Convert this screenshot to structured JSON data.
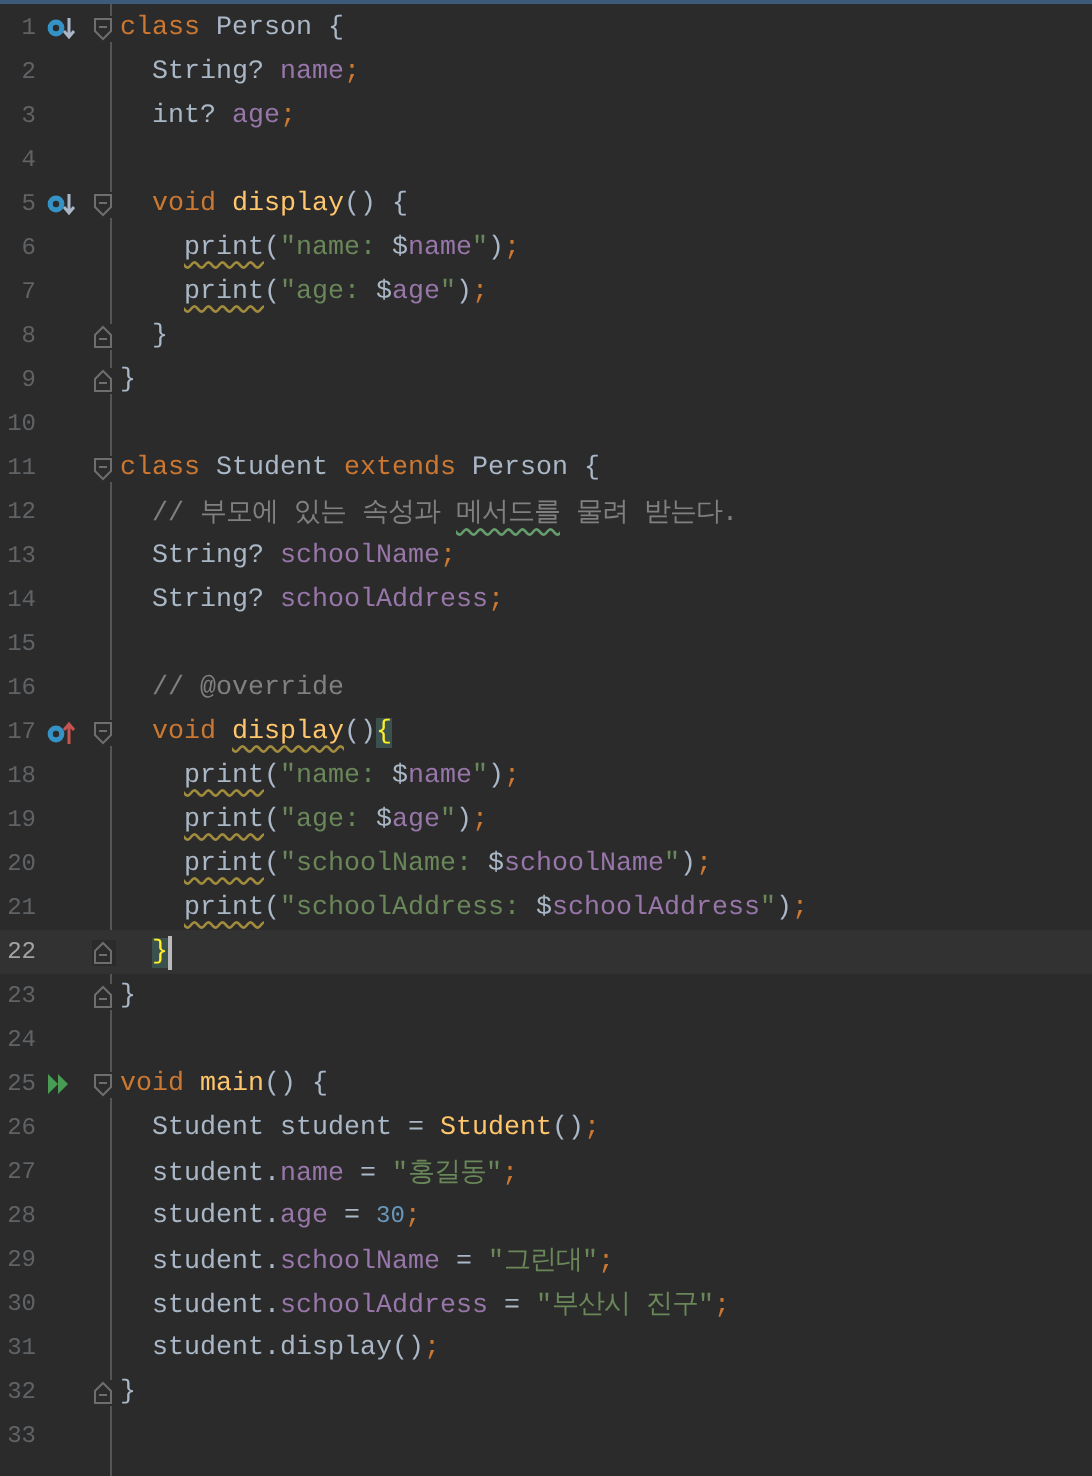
{
  "editor": {
    "lines": [
      {
        "number": "1",
        "gutter": {
          "kind": "implemented"
        },
        "fold": {
          "kind": "open"
        },
        "current": false,
        "tokens": [
          {
            "text": "class",
            "kind": "kw"
          },
          {
            "text": " Person {",
            "kind": "plain"
          }
        ]
      },
      {
        "number": "2",
        "current": false,
        "tokens": [
          {
            "text": "  String? ",
            "kind": "plain"
          },
          {
            "text": "name",
            "kind": "field"
          },
          {
            "text": ";",
            "kind": "punct"
          }
        ]
      },
      {
        "number": "3",
        "current": false,
        "tokens": [
          {
            "text": "  int? ",
            "kind": "plain"
          },
          {
            "text": "age",
            "kind": "field"
          },
          {
            "text": ";",
            "kind": "punct"
          }
        ]
      },
      {
        "number": "4",
        "current": false
      },
      {
        "number": "5",
        "gutter": {
          "kind": "implemented"
        },
        "fold": {
          "kind": "open"
        },
        "current": false,
        "tokens": [
          {
            "text": "  void ",
            "kind": "kw"
          },
          {
            "text": "display",
            "kind": "fn"
          },
          {
            "text": "() {",
            "kind": "plain"
          }
        ]
      },
      {
        "number": "6",
        "current": false,
        "tokens": [
          {
            "text": "    print",
            "kind": "call-warning"
          },
          {
            "text": "(",
            "kind": "plain"
          },
          {
            "text": "\"name: ",
            "kind": "str"
          },
          {
            "text": "$",
            "kind": "plain"
          },
          {
            "text": "name",
            "kind": "field"
          },
          {
            "text": "\"",
            "kind": "str"
          },
          {
            "text": ")",
            "kind": "plain"
          },
          {
            "text": ";",
            "kind": "punct"
          }
        ]
      },
      {
        "number": "7",
        "current": false,
        "tokens": [
          {
            "text": "    print",
            "kind": "call-warning"
          },
          {
            "text": "(",
            "kind": "plain"
          },
          {
            "text": "\"age: ",
            "kind": "str"
          },
          {
            "text": "$",
            "kind": "plain"
          },
          {
            "text": "age",
            "kind": "field"
          },
          {
            "text": "\"",
            "kind": "str"
          },
          {
            "text": ")",
            "kind": "plain"
          },
          {
            "text": ";",
            "kind": "punct"
          }
        ]
      },
      {
        "number": "8",
        "fold": {
          "kind": "close"
        },
        "current": false,
        "tokens": [
          {
            "text": "  }",
            "kind": "plain"
          }
        ]
      },
      {
        "number": "9",
        "fold": {
          "kind": "close"
        },
        "current": false,
        "tokens": [
          {
            "text": "}",
            "kind": "plain"
          }
        ]
      },
      {
        "number": "10",
        "current": false
      },
      {
        "number": "11",
        "fold": {
          "kind": "open"
        },
        "current": false,
        "tokens": [
          {
            "text": "class",
            "kind": "kw"
          },
          {
            "text": " Student ",
            "kind": "plain"
          },
          {
            "text": "extends",
            "kind": "kw"
          },
          {
            "text": " Person {",
            "kind": "plain"
          }
        ]
      },
      {
        "number": "12",
        "current": false,
        "tokens": [
          {
            "text": "  // 부모에 있는 속성과 ",
            "kind": "comment"
          },
          {
            "text": "메서드를",
            "kind": "comment-typo"
          },
          {
            "text": " 물려 받는다.",
            "kind": "comment"
          }
        ]
      },
      {
        "number": "13",
        "current": false,
        "tokens": [
          {
            "text": "  String? ",
            "kind": "plain"
          },
          {
            "text": "schoolName",
            "kind": "field"
          },
          {
            "text": ";",
            "kind": "punct"
          }
        ]
      },
      {
        "number": "14",
        "current": false,
        "tokens": [
          {
            "text": "  String? ",
            "kind": "plain"
          },
          {
            "text": "schoolAddress",
            "kind": "field"
          },
          {
            "text": ";",
            "kind": "punct"
          }
        ]
      },
      {
        "number": "15",
        "current": false
      },
      {
        "number": "16",
        "current": false,
        "tokens": [
          {
            "text": "  // @override",
            "kind": "comment"
          }
        ]
      },
      {
        "number": "17",
        "gutter": {
          "kind": "overrides"
        },
        "fold": {
          "kind": "open"
        },
        "current": false,
        "tokens": [
          {
            "text": "  void ",
            "kind": "kw"
          },
          {
            "text": "display",
            "kind": "fn-warning"
          },
          {
            "text": "()",
            "kind": "plain"
          },
          {
            "text": "{",
            "kind": "brace-match"
          }
        ]
      },
      {
        "number": "18",
        "current": false,
        "tokens": [
          {
            "text": "    print",
            "kind": "call-warning"
          },
          {
            "text": "(",
            "kind": "plain"
          },
          {
            "text": "\"name: ",
            "kind": "str"
          },
          {
            "text": "$",
            "kind": "plain"
          },
          {
            "text": "name",
            "kind": "field"
          },
          {
            "text": "\"",
            "kind": "str"
          },
          {
            "text": ")",
            "kind": "plain"
          },
          {
            "text": ";",
            "kind": "punct"
          }
        ]
      },
      {
        "number": "19",
        "current": false,
        "tokens": [
          {
            "text": "    print",
            "kind": "call-warning"
          },
          {
            "text": "(",
            "kind": "plain"
          },
          {
            "text": "\"age: ",
            "kind": "str"
          },
          {
            "text": "$",
            "kind": "plain"
          },
          {
            "text": "age",
            "kind": "field"
          },
          {
            "text": "\"",
            "kind": "str"
          },
          {
            "text": ")",
            "kind": "plain"
          },
          {
            "text": ";",
            "kind": "punct"
          }
        ]
      },
      {
        "number": "20",
        "current": false,
        "tokens": [
          {
            "text": "    print",
            "kind": "call-warning"
          },
          {
            "text": "(",
            "kind": "plain"
          },
          {
            "text": "\"schoolName: ",
            "kind": "str"
          },
          {
            "text": "$",
            "kind": "plain"
          },
          {
            "text": "schoolName",
            "kind": "field"
          },
          {
            "text": "\"",
            "kind": "str"
          },
          {
            "text": ")",
            "kind": "plain"
          },
          {
            "text": ";",
            "kind": "punct"
          }
        ]
      },
      {
        "number": "21",
        "current": false,
        "tokens": [
          {
            "text": "    print",
            "kind": "call-warning"
          },
          {
            "text": "(",
            "kind": "plain"
          },
          {
            "text": "\"schoolAddress: ",
            "kind": "str"
          },
          {
            "text": "$",
            "kind": "plain"
          },
          {
            "text": "schoolAddress",
            "kind": "field"
          },
          {
            "text": "\"",
            "kind": "str"
          },
          {
            "text": ")",
            "kind": "plain"
          },
          {
            "text": ";",
            "kind": "punct"
          }
        ]
      },
      {
        "number": "22",
        "fold": {
          "kind": "close"
        },
        "current": true,
        "tokens": [
          {
            "text": "  }",
            "kind": "brace-match"
          }
        ]
      },
      {
        "number": "23",
        "fold": {
          "kind": "close"
        },
        "current": false,
        "tokens": [
          {
            "text": "}",
            "kind": "plain"
          }
        ]
      },
      {
        "number": "24",
        "current": false
      },
      {
        "number": "25",
        "gutter": {
          "kind": "run"
        },
        "fold": {
          "kind": "open"
        },
        "current": false,
        "tokens": [
          {
            "text": "void ",
            "kind": "kw"
          },
          {
            "text": "main",
            "kind": "fn"
          },
          {
            "text": "() {",
            "kind": "plain"
          }
        ]
      },
      {
        "number": "26",
        "current": false,
        "tokens": [
          {
            "text": "  Student student = ",
            "kind": "plain"
          },
          {
            "text": "Student",
            "kind": "fn"
          },
          {
            "text": "()",
            "kind": "plain"
          },
          {
            "text": ";",
            "kind": "punct"
          }
        ]
      },
      {
        "number": "27",
        "current": false,
        "tokens": [
          {
            "text": "  student.",
            "kind": "plain"
          },
          {
            "text": "name",
            "kind": "field"
          },
          {
            "text": " = ",
            "kind": "plain"
          },
          {
            "text": "\"홍길동\"",
            "kind": "str"
          },
          {
            "text": ";",
            "kind": "punct"
          }
        ]
      },
      {
        "number": "28",
        "current": false,
        "tokens": [
          {
            "text": "  student.",
            "kind": "plain"
          },
          {
            "text": "age",
            "kind": "field"
          },
          {
            "text": " = ",
            "kind": "plain"
          },
          {
            "text": "30",
            "kind": "num"
          },
          {
            "text": ";",
            "kind": "punct"
          }
        ]
      },
      {
        "number": "29",
        "current": false,
        "tokens": [
          {
            "text": "  student.",
            "kind": "plain"
          },
          {
            "text": "schoolName",
            "kind": "field"
          },
          {
            "text": " = ",
            "kind": "plain"
          },
          {
            "text": "\"그린대\"",
            "kind": "str"
          },
          {
            "text": ";",
            "kind": "punct"
          }
        ]
      },
      {
        "number": "30",
        "current": false,
        "tokens": [
          {
            "text": "  student.",
            "kind": "plain"
          },
          {
            "text": "schoolAddress",
            "kind": "field"
          },
          {
            "text": " = ",
            "kind": "plain"
          },
          {
            "text": "\"부산시 진구\"",
            "kind": "str"
          },
          {
            "text": ";",
            "kind": "punct"
          }
        ]
      },
      {
        "number": "31",
        "current": false,
        "tokens": [
          {
            "text": "  student.display()",
            "kind": "plain"
          },
          {
            "text": ";",
            "kind": "punct"
          }
        ]
      },
      {
        "number": "32",
        "fold": {
          "kind": "close"
        },
        "current": false,
        "tokens": [
          {
            "text": "}",
            "kind": "plain"
          }
        ]
      },
      {
        "number": "33",
        "current": false
      }
    ]
  }
}
